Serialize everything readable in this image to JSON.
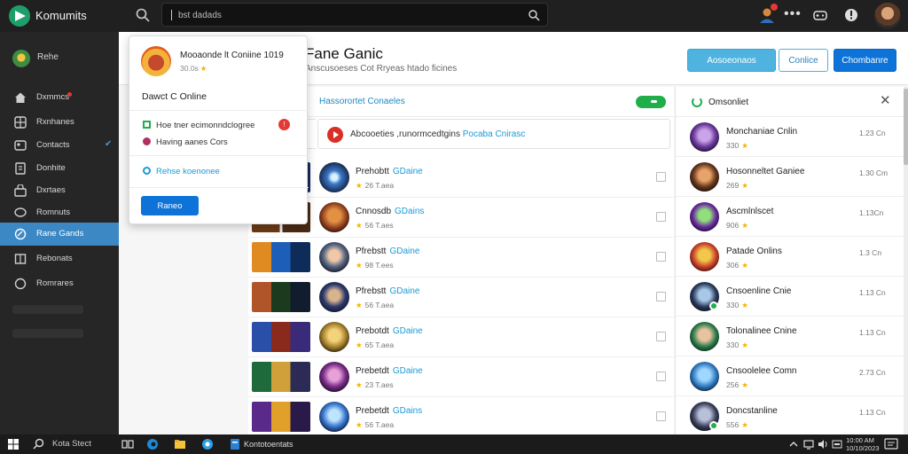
{
  "app": {
    "name": "Komumits"
  },
  "search": {
    "value": "bst dadads"
  },
  "sidebar": {
    "user_label": "Rehe",
    "items": [
      {
        "label": "Dxmmcs",
        "icon": "home-icon"
      },
      {
        "label": "Rxnhanes",
        "icon": "grid-icon"
      },
      {
        "label": "Contacts",
        "icon": "contacts-icon"
      },
      {
        "label": "Donhite",
        "icon": "document-icon"
      },
      {
        "label": "Dxrtaes",
        "icon": "store-icon"
      },
      {
        "label": "Romnuts",
        "icon": "chat-icon"
      },
      {
        "label": "Rane Gands",
        "icon": "gamepad-icon"
      },
      {
        "label": "Rebonats",
        "icon": "book-icon"
      },
      {
        "label": "Romrares",
        "icon": "circle-icon"
      }
    ]
  },
  "header": {
    "title": "Fane Ganic",
    "subtitle": "Anscusoeses Cot Rryeas htado ficines",
    "buttons": [
      "Aosoeonaos",
      "Conlice",
      "Chombanre"
    ]
  },
  "panel": {
    "title": "Hassorortet Conaeles",
    "notice_text": "Abcooeties ,runormcedtgins",
    "notice_link": "Pocaba Cnirasc"
  },
  "rows": [
    {
      "title": "Prehobtt",
      "status": "GDaine",
      "meta": "26 T.aea"
    },
    {
      "title": "Cnnosdb",
      "status": "GDains",
      "meta": "56 T.aes"
    },
    {
      "title": "Pfrebstt",
      "status": "GDaine",
      "meta": "98 T.ees"
    },
    {
      "title": "Pfrebstt",
      "status": "GDaine",
      "meta": "56 T.aea"
    },
    {
      "title": "Prebotdt",
      "status": "GDaine",
      "meta": "65 T.aea"
    },
    {
      "title": "Prebetdt",
      "status": "GDaine",
      "meta": "23 T.aes"
    },
    {
      "title": "Prebetdt",
      "status": "GDains",
      "meta": "56 T.aea"
    }
  ],
  "right_panel": {
    "title": "Omsonliet",
    "users": [
      {
        "name": "Monchaniae Cnlin",
        "sub": "330",
        "time": "1.23 Cn",
        "status": false
      },
      {
        "name": "Hosonneltet Ganiee",
        "sub": "269",
        "time": "1.30 Cm",
        "status": false
      },
      {
        "name": "Ascmlnlscet",
        "sub": "906",
        "time": "1.13Cn",
        "status": false
      },
      {
        "name": "Patade Onlins",
        "sub": "306",
        "time": "1.3 Cn",
        "status": false
      },
      {
        "name": "Cnsoenline Cnie",
        "sub": "330",
        "time": "1.13 Cn",
        "status": true
      },
      {
        "name": "Tolonalinee Cnine",
        "sub": "330",
        "time": "1.13 Cn",
        "status": false
      },
      {
        "name": "Cnsoolelee Comn",
        "sub": "256",
        "time": "2.73 Cn",
        "status": false
      },
      {
        "name": "Doncstanline",
        "sub": "556",
        "time": "1.13 Cn",
        "status": true
      }
    ]
  },
  "popup": {
    "title": "Mooaonde lt Coniine 1019",
    "sub": "30.0s",
    "heading": "Dawct C Online",
    "line1": "Hoe tner ecimonndclogree",
    "line2": "Having aanes Cors",
    "alert": "!",
    "link": "Rehse koenonee",
    "button": "Raneo"
  },
  "taskbar": {
    "search_text": "Kota Stect",
    "active_app": "Kontotoentats",
    "clock_time": "10:00 AM",
    "clock_date": "10/10/2023"
  },
  "colors": {
    "accent": "#0d73d8",
    "link": "#1a9bd6",
    "online": "#1fae4a",
    "sidebar_active": "#3b88c4"
  }
}
